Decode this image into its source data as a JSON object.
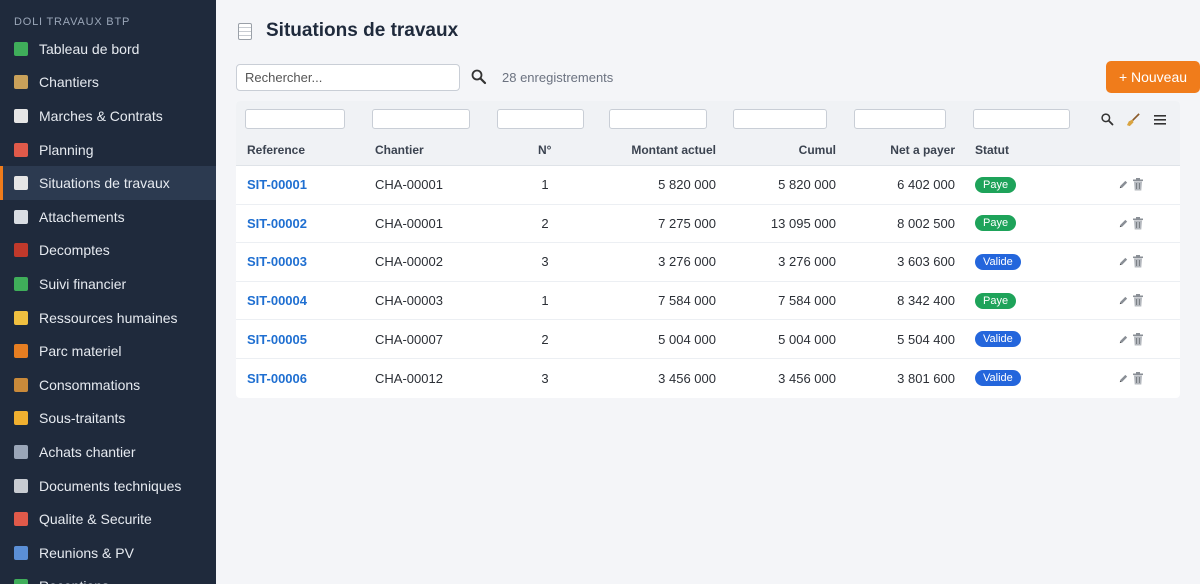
{
  "sidebar": {
    "brand": "DOLI TRAVAUX BTP",
    "items": [
      {
        "label": "Tableau de bord",
        "icon": "chart-icon",
        "color": "#3fae5a"
      },
      {
        "label": "Chantiers",
        "icon": "crane-icon",
        "color": "#c9a15a"
      },
      {
        "label": "Marches & Contrats",
        "icon": "document-icon",
        "color": "#e6e6e6"
      },
      {
        "label": "Planning",
        "icon": "calendar-icon",
        "color": "#e05a4a"
      },
      {
        "label": "Situations de travaux",
        "icon": "receipt-icon",
        "color": "#e6e6e6"
      },
      {
        "label": "Attachements",
        "icon": "ruler-icon",
        "color": "#d9dde3"
      },
      {
        "label": "Decomptes",
        "icon": "abacus-icon",
        "color": "#c0392b"
      },
      {
        "label": "Suivi financier",
        "icon": "money-icon",
        "color": "#3fae5a"
      },
      {
        "label": "Ressources humaines",
        "icon": "worker-icon",
        "color": "#f0c040"
      },
      {
        "label": "Parc materiel",
        "icon": "truck-icon",
        "color": "#e67e22"
      },
      {
        "label": "Consommations",
        "icon": "box-icon",
        "color": "#c98a3a"
      },
      {
        "label": "Sous-traitants",
        "icon": "handshake-icon",
        "color": "#f0b030"
      },
      {
        "label": "Achats chantier",
        "icon": "cart-icon",
        "color": "#9aa6b8"
      },
      {
        "label": "Documents techniques",
        "icon": "folder-icon",
        "color": "#c8ccd2"
      },
      {
        "label": "Qualite & Securite",
        "icon": "shield-icon",
        "color": "#e05a4a"
      },
      {
        "label": "Reunions & PV",
        "icon": "people-icon",
        "color": "#5b8fd6"
      },
      {
        "label": "Receptions",
        "icon": "check-icon",
        "color": "#3fae5a"
      }
    ],
    "active_index": 4
  },
  "header": {
    "title": "Situations de travaux"
  },
  "toolbar": {
    "search_placeholder": "Rechercher...",
    "count_text": "28 enregistrements",
    "new_label": "+ Nouveau"
  },
  "table": {
    "columns": [
      "Reference",
      "Chantier",
      "N°",
      "Montant actuel",
      "Cumul",
      "Net a payer",
      "Statut"
    ],
    "rows": [
      {
        "ref": "SIT-00001",
        "chantier": "CHA-00001",
        "num": "1",
        "montant": "5 820 000",
        "cumul": "5 820 000",
        "net": "6 402 000",
        "statut": "Paye"
      },
      {
        "ref": "SIT-00002",
        "chantier": "CHA-00001",
        "num": "2",
        "montant": "7 275 000",
        "cumul": "13 095 000",
        "net": "8 002 500",
        "statut": "Paye"
      },
      {
        "ref": "SIT-00003",
        "chantier": "CHA-00002",
        "num": "3",
        "montant": "3 276 000",
        "cumul": "3 276 000",
        "net": "3 603 600",
        "statut": "Valide"
      },
      {
        "ref": "SIT-00004",
        "chantier": "CHA-00003",
        "num": "1",
        "montant": "7 584 000",
        "cumul": "7 584 000",
        "net": "8 342 400",
        "statut": "Paye"
      },
      {
        "ref": "SIT-00005",
        "chantier": "CHA-00007",
        "num": "2",
        "montant": "5 004 000",
        "cumul": "5 004 000",
        "net": "5 504 400",
        "statut": "Valide"
      },
      {
        "ref": "SIT-00006",
        "chantier": "CHA-00012",
        "num": "3",
        "montant": "3 456 000",
        "cumul": "3 456 000",
        "net": "3 801 600",
        "statut": "Valide"
      }
    ]
  },
  "colors": {
    "accent": "#f07c1b",
    "link": "#1f6fd1",
    "paye": "#1ea35a",
    "valide": "#2466dc",
    "sidebar": "#1f2a3c"
  }
}
